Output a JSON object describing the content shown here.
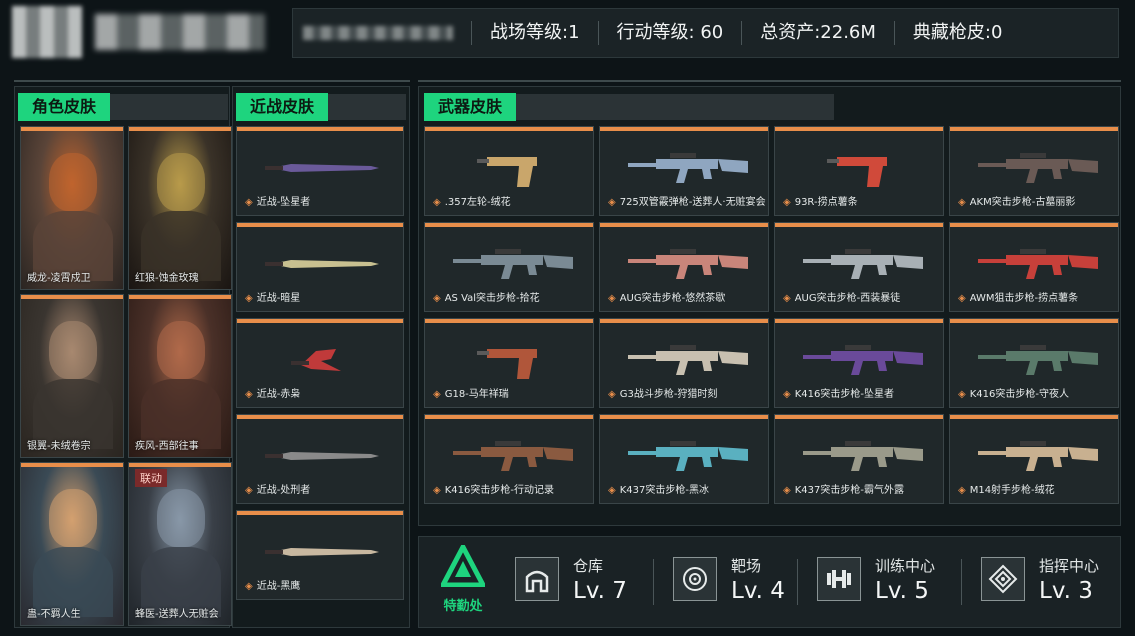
{
  "header": {
    "stats": [
      {
        "label": "战场等级:1"
      },
      {
        "label": "行动等级: 60"
      },
      {
        "label": "总资产:22.6M"
      },
      {
        "label": "典藏枪皮:0"
      }
    ]
  },
  "sections": {
    "character": "角色皮肤",
    "melee": "近战皮肤",
    "weapon": "武器皮肤"
  },
  "characters": [
    {
      "label": "威龙-凌霄戍卫"
    },
    {
      "label": "红狼-蚀金玫瑰"
    },
    {
      "label": "银翼-未绒卷宗"
    },
    {
      "label": "疾风-西部往事"
    },
    {
      "label": "蛊-不羁人生"
    },
    {
      "label": "蜂医-送葬人无赃会",
      "badge": "联动"
    }
  ],
  "melee": [
    {
      "label": "近战-坠星者"
    },
    {
      "label": "近战-暗星"
    },
    {
      "label": "近战-赤枭"
    },
    {
      "label": "近战-处刑者"
    },
    {
      "label": "近战-黑鹰"
    }
  ],
  "weapons": [
    {
      "label": ".357左轮-绒花",
      "color": "#c9a66b"
    },
    {
      "label": "725双管霰弹枪-送葬人·无赃宴会",
      "color": "#8fa6c0"
    },
    {
      "label": "93R-捞点薯条",
      "color": "#d04a3a"
    },
    {
      "label": "AKM突击步枪-古墓丽影",
      "color": "#6a5a55"
    },
    {
      "label": "AS Val突击步枪-拾花",
      "color": "#7a8a94"
    },
    {
      "label": "AUG突击步枪-悠然茶歇",
      "color": "#c9857a"
    },
    {
      "label": "AUG突击步枪-西装暴徒",
      "color": "#a8b0b5"
    },
    {
      "label": "AWM狙击步枪-捞点薯条",
      "color": "#c7403a"
    },
    {
      "label": "G18-马年祥瑞",
      "color": "#b0563a"
    },
    {
      "label": "G3战斗步枪-狩猎时刻",
      "color": "#c8c0b0"
    },
    {
      "label": "K416突击步枪-坠星者",
      "color": "#6a4a9a"
    },
    {
      "label": "K416突击步枪-守夜人",
      "color": "#5a7a6a"
    },
    {
      "label": "K416突击步枪-行动记录",
      "color": "#8a5a40"
    },
    {
      "label": "K437突击步枪-黑冰",
      "color": "#5ab0c0"
    },
    {
      "label": "K437突击步枪-霸气外露",
      "color": "#9a9a8a"
    },
    {
      "label": "M14射手步枪-绒花",
      "color": "#c8b090"
    }
  ],
  "footer": {
    "logo_label": "特勤处",
    "facilities": [
      {
        "name": "仓库",
        "level": "Lv. 7",
        "icon": "warehouse-icon"
      },
      {
        "name": "靶场",
        "level": "Lv. 4",
        "icon": "target-icon"
      },
      {
        "name": "训练中心",
        "level": "Lv. 5",
        "icon": "dumbbell-icon"
      },
      {
        "name": "指挥中心",
        "level": "Lv. 3",
        "icon": "command-icon"
      }
    ]
  }
}
